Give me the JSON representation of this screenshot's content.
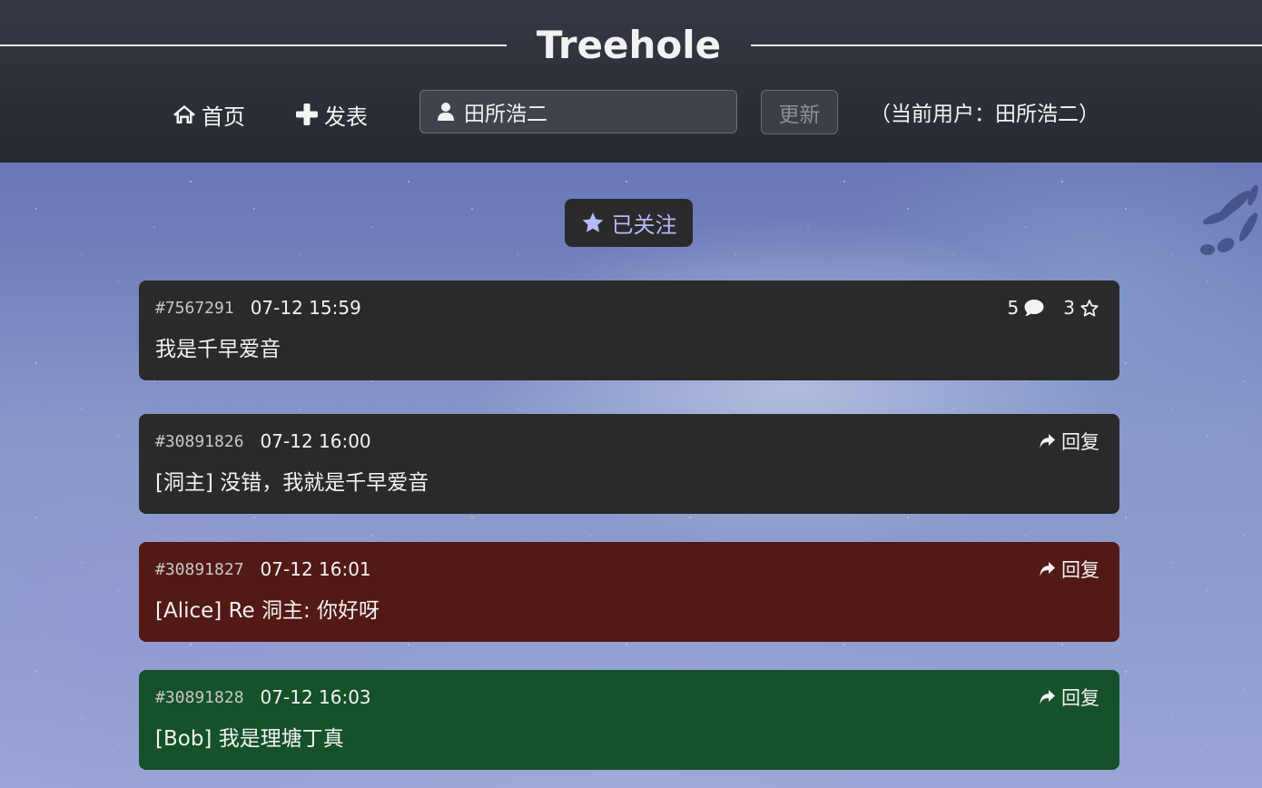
{
  "header": {
    "title": "Treehole",
    "nav": {
      "home_label": "首页",
      "home_icon": "home-icon",
      "post_label": "发表",
      "post_icon": "plus-icon"
    },
    "name_input": {
      "value": "田所浩二",
      "icon": "user-icon"
    },
    "update_button_label": "更新",
    "current_user_text": "（当前用户：田所浩二）"
  },
  "follow_badge": {
    "label": "已关注",
    "icon": "star-icon",
    "color": "#b6b9f7"
  },
  "main_post": {
    "pid": "#7567291",
    "time": "07-12 15:59",
    "text": "我是千早爱音",
    "reply_count": "5",
    "star_count": "3",
    "background": "#2a2a2a"
  },
  "replies": [
    {
      "pid": "#30891826",
      "time": "07-12 16:00",
      "text": "[洞主] 没错，我就是千早爱音",
      "reply_label": "回复",
      "background": "#2a2a2a"
    },
    {
      "pid": "#30891827",
      "time": "07-12 16:01",
      "text": "[Alice] Re 洞主: 你好呀",
      "reply_label": "回复",
      "background": "#521915"
    },
    {
      "pid": "#30891828",
      "time": "07-12 16:03",
      "text": "[Bob] 我是理塘丁真",
      "reply_label": "回复",
      "background": "#155129"
    }
  ]
}
